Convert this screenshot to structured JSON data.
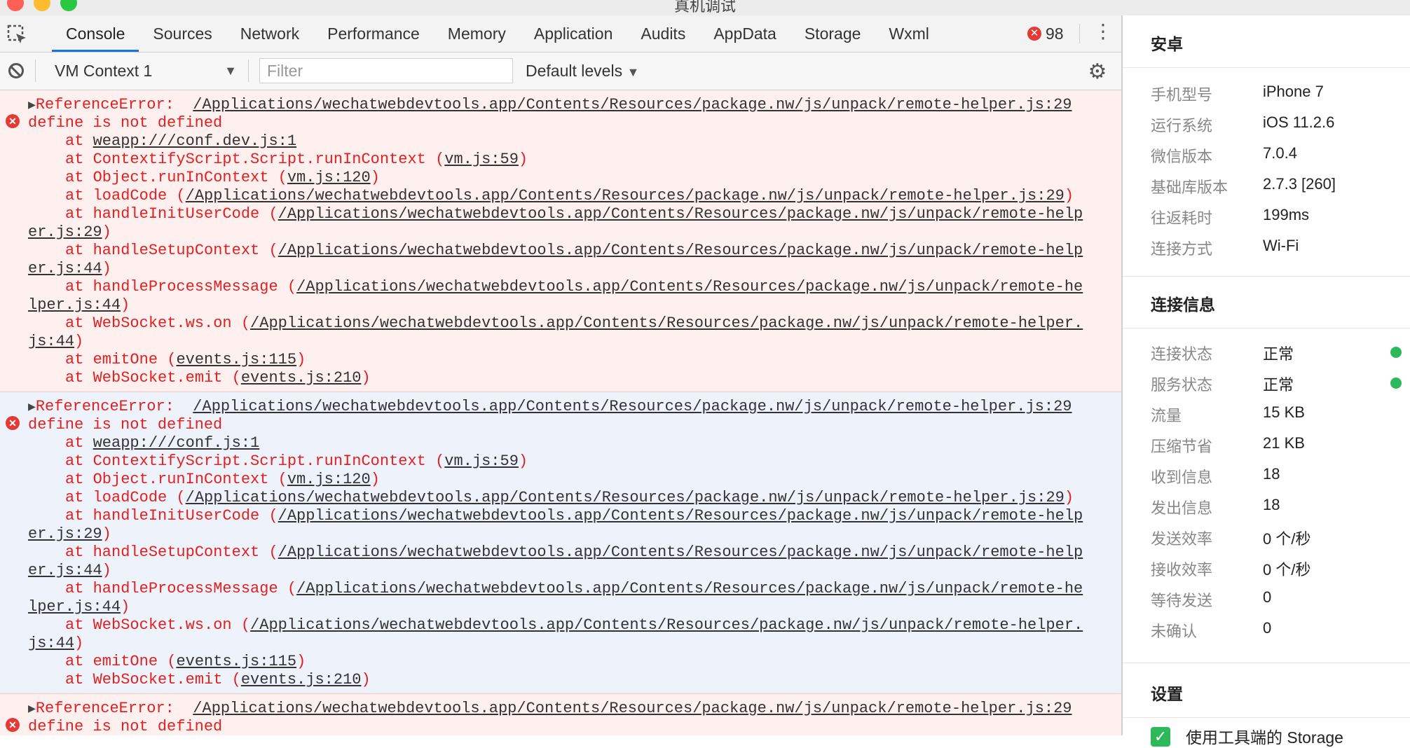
{
  "window": {
    "title": "真机调试",
    "traffic_colors": [
      "#fe5f57",
      "#febc2e",
      "#28c840"
    ]
  },
  "devtools": {
    "tabs": [
      {
        "label": "Console",
        "active": true
      },
      {
        "label": "Sources"
      },
      {
        "label": "Network"
      },
      {
        "label": "Performance"
      },
      {
        "label": "Memory"
      },
      {
        "label": "Application"
      },
      {
        "label": "Audits"
      },
      {
        "label": "AppData"
      },
      {
        "label": "Storage"
      },
      {
        "label": "Wxml"
      }
    ],
    "error_count": "98",
    "accent_color": "#1a73e8",
    "toolbar": {
      "context": "VM Context 1",
      "filter_placeholder": "Filter",
      "levels": "Default levels"
    }
  },
  "console": {
    "messages": [
      {
        "background": "pink",
        "title": "ReferenceError:",
        "source": "/Applications/wechatwebdevtools.app/Contents/Resources/package.nw/js/unpack/remote-helper.js:29",
        "message": "define is not defined",
        "stack": [
          {
            "fn": "at ",
            "link": "weapp:///conf.dev.js:1"
          },
          {
            "fn": "at ContextifyScript.Script.runInContext (",
            "link": "vm.js:59",
            "after": ")"
          },
          {
            "fn": "at Object.runInContext (",
            "link": "vm.js:120",
            "after": ")"
          },
          {
            "fn": "at loadCode (",
            "link": "/Applications/wechatwebdevtools.app/Contents/Resources/package.nw/js/unpack/remote-helper.js:29",
            "after": ")"
          },
          {
            "fn": "at handleInitUserCode (",
            "link": "/Applications/wechatwebdevtools.app/Contents/Resources/package.nw/js/unpack/remote-help",
            "cont": "er.js:29",
            "after": ")"
          },
          {
            "fn": "at handleSetupContext (",
            "link": "/Applications/wechatwebdevtools.app/Contents/Resources/package.nw/js/unpack/remote-help",
            "cont": "er.js:44",
            "after": ")"
          },
          {
            "fn": "at handleProcessMessage (",
            "link": "/Applications/wechatwebdevtools.app/Contents/Resources/package.nw/js/unpack/remote-he",
            "cont": "lper.js:44",
            "after": ")"
          },
          {
            "fn": "at WebSocket.ws.on (",
            "link": "/Applications/wechatwebdevtools.app/Contents/Resources/package.nw/js/unpack/remote-helper.",
            "cont": "js:44",
            "after": ")"
          },
          {
            "fn": "at emitOne (",
            "link": "events.js:115",
            "after": ")"
          },
          {
            "fn": "at WebSocket.emit (",
            "link": "events.js:210",
            "after": ")"
          }
        ]
      },
      {
        "background": "blue",
        "title": "ReferenceError:",
        "source": "/Applications/wechatwebdevtools.app/Contents/Resources/package.nw/js/unpack/remote-helper.js:29",
        "message": "define is not defined",
        "stack": [
          {
            "fn": "at ",
            "link": "weapp:///conf.js:1"
          },
          {
            "fn": "at ContextifyScript.Script.runInContext (",
            "link": "vm.js:59",
            "after": ")"
          },
          {
            "fn": "at Object.runInContext (",
            "link": "vm.js:120",
            "after": ")"
          },
          {
            "fn": "at loadCode (",
            "link": "/Applications/wechatwebdevtools.app/Contents/Resources/package.nw/js/unpack/remote-helper.js:29",
            "after": ")"
          },
          {
            "fn": "at handleInitUserCode (",
            "link": "/Applications/wechatwebdevtools.app/Contents/Resources/package.nw/js/unpack/remote-help",
            "cont": "er.js:29",
            "after": ")"
          },
          {
            "fn": "at handleSetupContext (",
            "link": "/Applications/wechatwebdevtools.app/Contents/Resources/package.nw/js/unpack/remote-help",
            "cont": "er.js:44",
            "after": ")"
          },
          {
            "fn": "at handleProcessMessage (",
            "link": "/Applications/wechatwebdevtools.app/Contents/Resources/package.nw/js/unpack/remote-he",
            "cont": "lper.js:44",
            "after": ")"
          },
          {
            "fn": "at WebSocket.ws.on (",
            "link": "/Applications/wechatwebdevtools.app/Contents/Resources/package.nw/js/unpack/remote-helper.",
            "cont": "js:44",
            "after": ")"
          },
          {
            "fn": "at emitOne (",
            "link": "events.js:115",
            "after": ")"
          },
          {
            "fn": "at WebSocket.emit (",
            "link": "events.js:210",
            "after": ")"
          }
        ]
      },
      {
        "background": "pink",
        "title": "ReferenceError:",
        "source": "/Applications/wechatwebdevtools.app/Contents/Resources/package.nw/js/unpack/remote-helper.js:29",
        "message": "define is not defined",
        "stack": []
      }
    ]
  },
  "panel": {
    "device": {
      "title": "安卓",
      "rows": [
        {
          "label": "手机型号",
          "value": "iPhone 7"
        },
        {
          "label": "运行系统",
          "value": "iOS 11.2.6"
        },
        {
          "label": "微信版本",
          "value": "7.0.4"
        },
        {
          "label": "基础库版本",
          "value": "2.7.3 [260]"
        },
        {
          "label": "往返耗时",
          "value": "199ms"
        },
        {
          "label": "连接方式",
          "value": "Wi-Fi"
        }
      ]
    },
    "connection": {
      "title": "连接信息",
      "rows": [
        {
          "label": "连接状态",
          "value": "正常",
          "status": true
        },
        {
          "label": "服务状态",
          "value": "正常",
          "status": true
        },
        {
          "label": "流量",
          "value": "15 KB"
        },
        {
          "label": "压缩节省",
          "value": "21 KB"
        },
        {
          "label": "收到信息",
          "value": "18"
        },
        {
          "label": "发出信息",
          "value": "18"
        },
        {
          "label": "发送效率",
          "value": "0 个/秒"
        },
        {
          "label": "接收效率",
          "value": "0 个/秒"
        },
        {
          "label": "等待发送",
          "value": "0"
        },
        {
          "label": "未确认",
          "value": "0"
        }
      ],
      "status_color": "#2eb85c"
    },
    "settings": {
      "title": "设置",
      "checkbox_label": "使用工具端的 Storage",
      "checked": true
    }
  }
}
